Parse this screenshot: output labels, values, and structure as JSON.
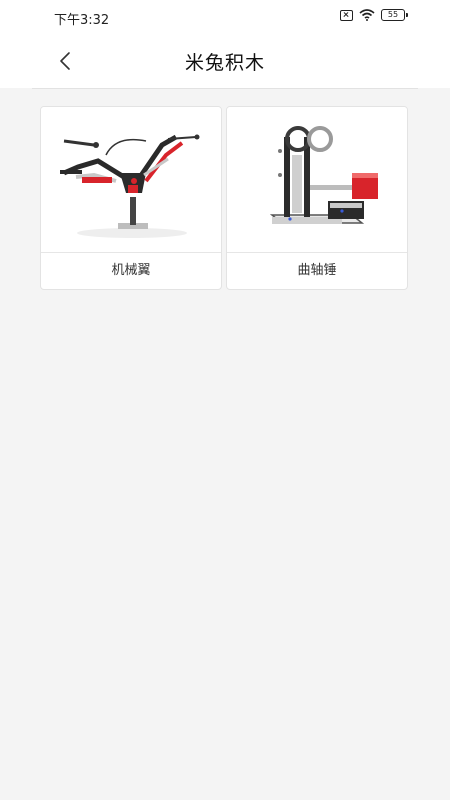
{
  "status_bar": {
    "time": "下午3:32",
    "battery": "55"
  },
  "header": {
    "title": "米兔积木"
  },
  "models": [
    {
      "label": "机械翼",
      "icon": "mechanical-wing-model-image"
    },
    {
      "label": "曲轴锤",
      "icon": "crank-hammer-model-image"
    }
  ],
  "colors": {
    "header_bg": "#ffffff",
    "page_bg": "#f4f4f4",
    "accent_red": "#d8242b"
  }
}
